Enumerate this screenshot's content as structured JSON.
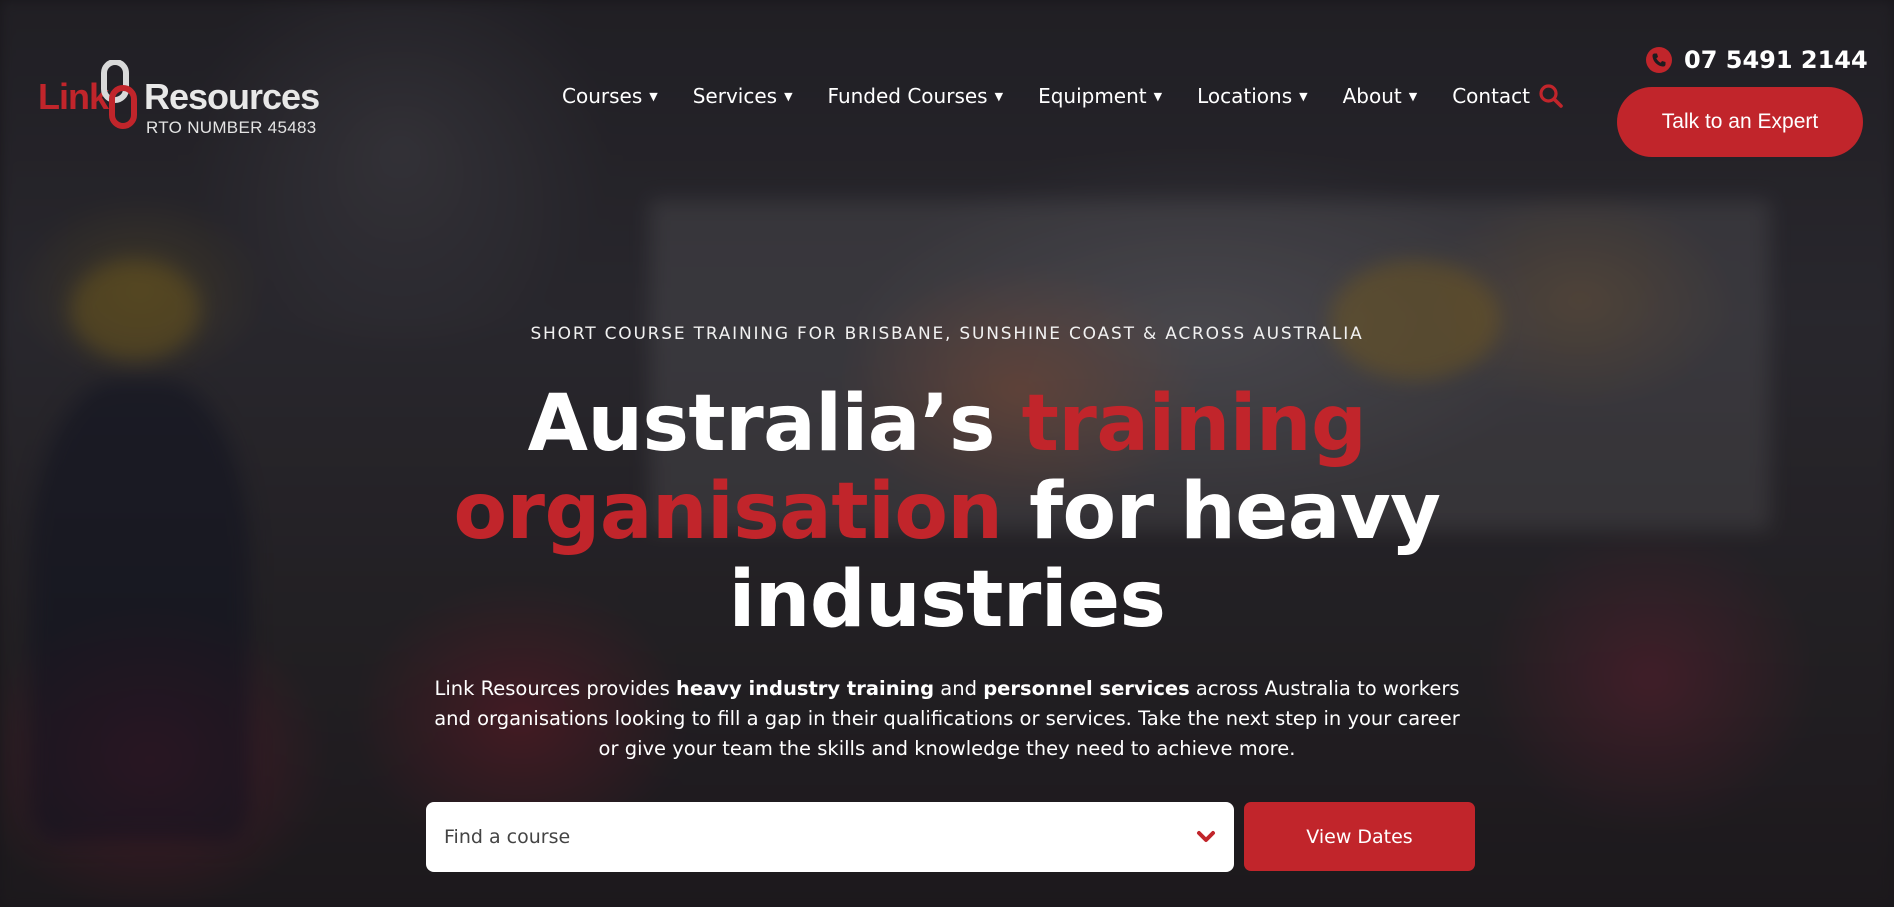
{
  "brand": {
    "logo_link": "Link",
    "logo_resources": "Resources",
    "rto_number": "RTO NUMBER 45483",
    "accent_color": "#c1252b"
  },
  "nav": {
    "items": [
      {
        "label": "Courses",
        "has_dropdown": true
      },
      {
        "label": "Services",
        "has_dropdown": true
      },
      {
        "label": "Funded Courses",
        "has_dropdown": true
      },
      {
        "label": "Equipment",
        "has_dropdown": true
      },
      {
        "label": "Locations",
        "has_dropdown": true
      },
      {
        "label": "About",
        "has_dropdown": true
      },
      {
        "label": "Contact",
        "has_dropdown": false
      }
    ],
    "caret": "▼",
    "search_icon": "search-icon"
  },
  "header": {
    "phone": "07 5491 2144",
    "phone_icon": "phone-icon",
    "cta_label": "Talk to an Expert"
  },
  "hero": {
    "kicker": "SHORT COURSE TRAINING FOR BRISBANE, SUNSHINE COAST & ACROSS AUSTRALIA",
    "headline": {
      "part1": "Australia’s ",
      "accent": "training organisation",
      "part2": " for heavy industries"
    },
    "intro": {
      "t1": "Link Resources provides ",
      "b1": "heavy industry training",
      "t2": " and ",
      "b2": "personnel services",
      "t3": " across Australia to workers and organisations looking to fill a gap in their qualifications or services. Take the next step in your career or give your team the skills and knowledge they need to achieve more."
    }
  },
  "search": {
    "placeholder": "Find a course",
    "button_label": "View Dates",
    "chevron_icon": "chevron-down-icon"
  }
}
